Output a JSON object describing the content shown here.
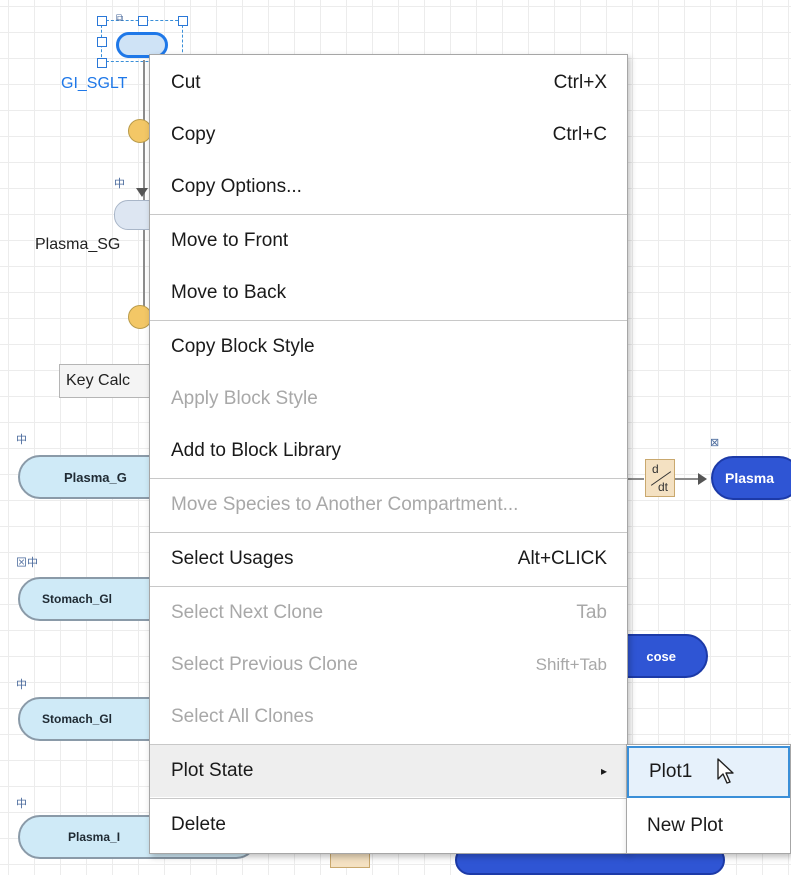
{
  "canvas": {
    "gi_label": "GI_SGLT",
    "plasma_sg_label": "Plasma_SG",
    "key_calc_label": "Key Calc",
    "blocks": [
      {
        "id": "plasma_g",
        "label": "Plasma_G"
      },
      {
        "id": "stomach_gl_1",
        "label": "Stomach_Gl"
      },
      {
        "id": "stomach_gl_2",
        "label": "Stomach_Gl"
      },
      {
        "id": "plasma_i",
        "label": "Plasma_I"
      }
    ],
    "right_block_label": "Plasma",
    "cose_label": "cose",
    "deriv_num": "d",
    "deriv_den": "dt"
  },
  "context_menu": {
    "items": [
      {
        "label": "Cut",
        "shortcut": "Ctrl+X",
        "enabled": true
      },
      {
        "label": "Copy",
        "shortcut": "Ctrl+C",
        "enabled": true
      },
      {
        "label": "Copy Options...",
        "shortcut": "",
        "enabled": true
      },
      {
        "label": "Move to Front",
        "shortcut": "",
        "enabled": true
      },
      {
        "label": "Move to Back",
        "shortcut": "",
        "enabled": true
      },
      {
        "label": "Copy Block Style",
        "shortcut": "",
        "enabled": true
      },
      {
        "label": "Apply Block Style",
        "shortcut": "",
        "enabled": false
      },
      {
        "label": "Add to Block Library",
        "shortcut": "",
        "enabled": true
      },
      {
        "label": "Move Species to Another Compartment...",
        "shortcut": "",
        "enabled": false
      },
      {
        "label": "Select Usages",
        "shortcut": "Alt+CLICK",
        "enabled": true
      },
      {
        "label": "Select Next Clone",
        "shortcut": "Tab",
        "enabled": false
      },
      {
        "label": "Select Previous Clone",
        "shortcut": "Shift+Tab",
        "enabled": false
      },
      {
        "label": "Select All Clones",
        "shortcut": "",
        "enabled": false
      },
      {
        "label": "Plot State",
        "shortcut": "▸",
        "enabled": true
      },
      {
        "label": "Delete",
        "shortcut": "",
        "enabled": true
      }
    ]
  },
  "submenu": {
    "items": [
      {
        "label": "Plot1",
        "selected": true
      },
      {
        "label": "New Plot",
        "selected": false
      }
    ]
  },
  "icons": {
    "submenu_arrow": "triangle-right-icon",
    "cursor": "mouse-pointer-icon",
    "clone": "clone-indicator-icon"
  }
}
